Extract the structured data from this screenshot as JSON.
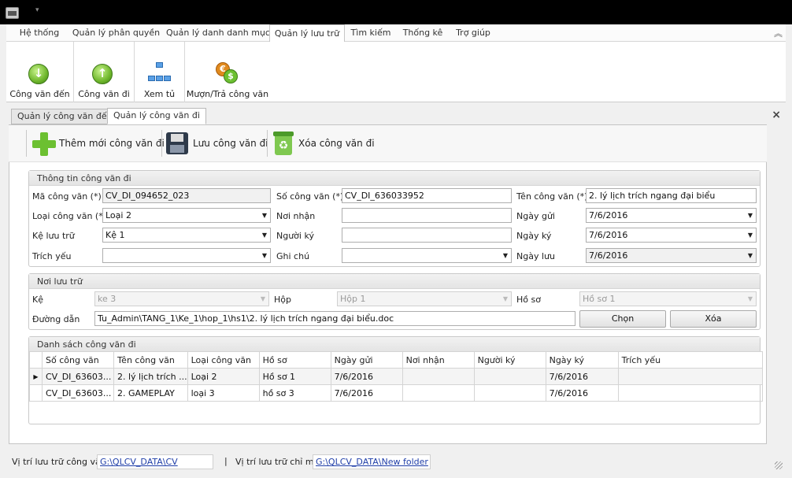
{
  "quick_access": "▾",
  "ribbon_tabs": [
    "Hệ thống",
    "Quản lý phân quyền",
    "Quản lý danh danh mục",
    "Quản lý lưu trữ",
    "Tìm kiếm",
    "Thống kê",
    "Trợ giúp"
  ],
  "ribbon_buttons": [
    "Công văn đến",
    "Công văn đi",
    "Xem tủ",
    "Mượn/Trả công văn"
  ],
  "doc_tabs": [
    "Quản lý công văn đến",
    "Quản lý công văn đi"
  ],
  "toolbar": {
    "add": "Thêm mới công văn đi",
    "save": "Lưu công văn đi",
    "delete": "Xóa công văn đi"
  },
  "info": {
    "title": "Thông tin công văn đi",
    "ma_label": "Mã công văn (*)",
    "ma_value": "CV_DI_094652_023",
    "so_label": "Số công văn (*)",
    "so_value": "CV_DI_636033952",
    "ten_label": "Tên công văn (*)",
    "ten_value": "2. lý lịch trích ngang đại biểu",
    "loai_label": "Loại công văn (*)",
    "loai_value": "Loại 2",
    "noinhan_label": "Nơi nhận",
    "noinhan_value": "",
    "ngaygui_label": "Ngày gửi",
    "ngaygui_value": "7/6/2016",
    "ke_label": "Kệ lưu trữ",
    "ke_value": "Kệ 1",
    "nguoiky_label": "Người ký",
    "nguoiky_value": "",
    "ngayky_label": "Ngày ký",
    "ngayky_value": "7/6/2016",
    "trichyeu_label": "Trích yếu",
    "trichyeu_value": "",
    "ghichu_label": "Ghi chú",
    "ghichu_value": "",
    "ngayluu_label": "Ngày lưu",
    "ngayluu_value": "7/6/2016"
  },
  "storage": {
    "title": "Nơi lưu trữ",
    "ke_label": "Kệ",
    "ke_value": "ke 3",
    "hop_label": "Hộp",
    "hop_value": "Hộp 1",
    "hoso_label": "Hồ sơ",
    "hoso_value": "Hồ sơ 1",
    "path_label": "Đường dẫn",
    "path_value": "Tu_Admin\\TANG_1\\Ke_1\\hop_1\\hs1\\2. lý lịch trích ngang đại biểu.doc",
    "choose_btn": "Chọn",
    "delete_btn": "Xóa"
  },
  "list": {
    "title": "Danh sách công văn đi",
    "columns": [
      "Số công văn",
      "Tên công văn",
      "Loại công văn",
      "Hồ sơ",
      "Ngày gửi",
      "Nơi nhận",
      "Người ký",
      "Ngày ký",
      "Trích yếu"
    ],
    "rows": [
      [
        "CV_DI_63603...",
        "2. lý lịch trích ...",
        "Loại 2",
        "Hồ sơ 1",
        "7/6/2016",
        "",
        "",
        "7/6/2016",
        ""
      ],
      [
        "CV_DI_63603...",
        "2. GAMEPLAY",
        "loại 3",
        "hồ sơ 3",
        "7/6/2016",
        "",
        "",
        "7/6/2016",
        ""
      ]
    ]
  },
  "status": {
    "cv_label": "Vị trí lưu trữ công văn",
    "cv_path": "G:\\QLCV_DATA\\CV",
    "sep": "|",
    "cm_label": "Vị trí lưu trữ chỉ mục",
    "cm_path": "G:\\QLCV_DATA\\New folder"
  }
}
